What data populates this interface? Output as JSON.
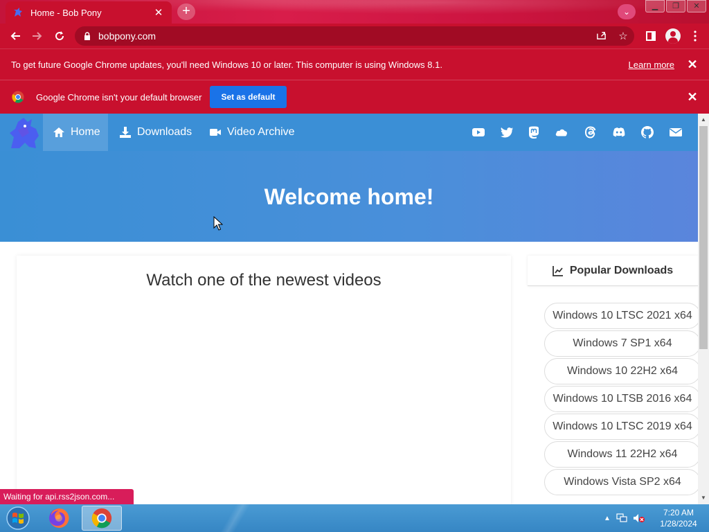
{
  "browser": {
    "tab_title": "Home - Bob Pony",
    "url": "bobpony.com",
    "accent": "#c8102e"
  },
  "infobar_update": {
    "message": "To get future Google Chrome updates, you'll need Windows 10 or later. This computer is using Windows 8.1.",
    "link": "Learn more"
  },
  "infobar_default": {
    "message": "Google Chrome isn't your default browser",
    "button": "Set as default"
  },
  "site": {
    "nav": [
      {
        "label": "Home",
        "icon": "home-icon"
      },
      {
        "label": "Downloads",
        "icon": "download-icon"
      },
      {
        "label": "Video Archive",
        "icon": "video-icon"
      }
    ],
    "social_icons": [
      "youtube-icon",
      "twitter-icon",
      "mastodon-icon",
      "cloud-icon",
      "threads-icon",
      "discord-icon",
      "github-icon",
      "mail-icon"
    ],
    "hero_title": "Welcome home!",
    "main_title": "Watch one of the newest videos",
    "side_title": "Popular Downloads",
    "downloads": [
      "Windows 10 LTSC 2021 x64",
      "Windows 7 SP1 x64",
      "Windows 10 22H2 x64",
      "Windows 10 LTSB 2016 x64",
      "Windows 10 LTSC 2019 x64",
      "Windows 11 22H2 x64",
      "Windows Vista SP2 x64"
    ],
    "brand_color": "#3b8fd6"
  },
  "status": "Waiting for api.rss2json.com...",
  "taskbar": {
    "time": "7:20 AM",
    "date": "1/28/2024"
  }
}
